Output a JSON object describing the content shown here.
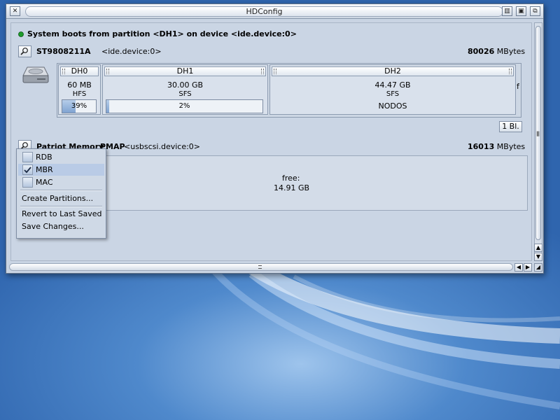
{
  "window": {
    "title": "HDConfig",
    "controls": {
      "close": "close-icon",
      "iconify": "iconify-icon",
      "snapshot": "snapshot-icon",
      "depth": "depth-icon"
    }
  },
  "boot_status": {
    "text": "System boots from partition <DH1> on device <ide.device:0>",
    "indicator_color": "#1e9c2a"
  },
  "devices": [
    {
      "name": "ST9808211A",
      "device": "<ide.device:0>",
      "size_value": "80026",
      "size_unit": "MBytes",
      "partitions": [
        {
          "name": "DH0",
          "size": "60 MB",
          "fs": "HFS",
          "usage_label": "39%",
          "usage_fraction": 0.39
        },
        {
          "name": "DH1",
          "size": "30.00 GB",
          "fs": "SFS",
          "usage_label": "2%",
          "usage_fraction": 0.02
        },
        {
          "name": "DH2",
          "size": "44.47 GB",
          "fs": "SFS",
          "status": "NODOS"
        }
      ],
      "trailing_char": "f",
      "blocks_button": "1 Bl."
    },
    {
      "name": "Patriot Memory",
      "table_type": "PMAP",
      "device": "<usbscsi.device:0>",
      "size_value": "16013",
      "size_unit": "MBytes",
      "free": {
        "label": "free:",
        "size": "14.91 GB"
      }
    }
  ],
  "context_menu": {
    "items": [
      {
        "label": "RDB",
        "checked": false
      },
      {
        "label": "MBR",
        "checked": true
      },
      {
        "label": "MAC",
        "checked": false
      }
    ],
    "actions": [
      "Create Partitions...",
      "Revert to Last Saved",
      "Save Changes..."
    ]
  },
  "scrollbars": {
    "vertical": {
      "up": "up-arrow-icon",
      "down": "down-arrow-icon"
    },
    "horizontal": {
      "left": "left-arrow-icon",
      "right": "right-arrow-icon"
    }
  },
  "colors": {
    "window_bg": "#c9d4e3",
    "accent": "#7fa3d1",
    "desktop": "#4f89cc"
  }
}
